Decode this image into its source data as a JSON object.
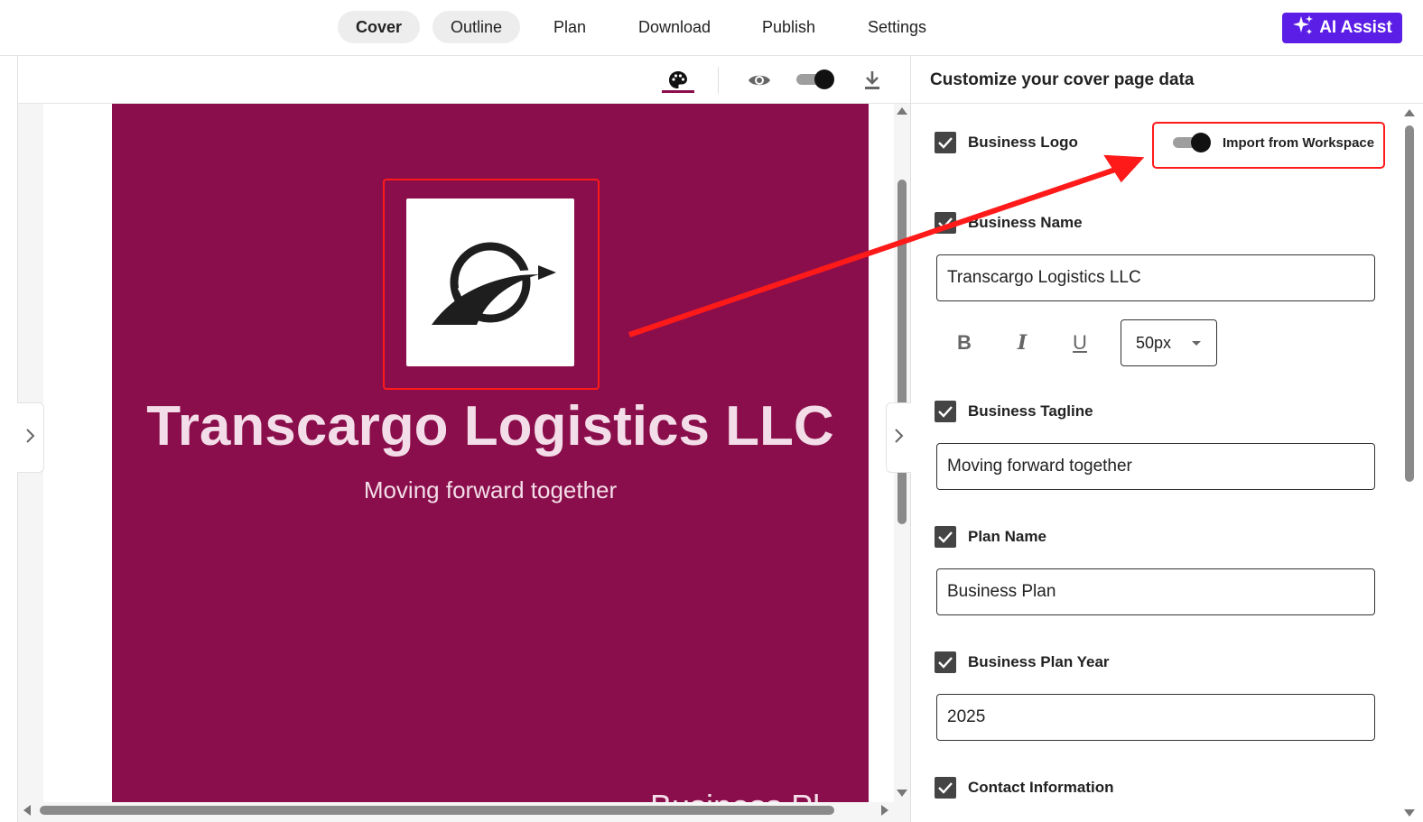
{
  "nav": {
    "tabs": [
      {
        "label": "Cover",
        "active": true
      },
      {
        "label": "Outline",
        "active": false
      },
      {
        "label": "Plan",
        "active": false
      },
      {
        "label": "Download",
        "active": false
      },
      {
        "label": "Publish",
        "active": false
      },
      {
        "label": "Settings",
        "active": false
      }
    ],
    "ai_button": {
      "label": "AI Assist",
      "icon": "sparkles-icon",
      "color": "#5b1ee6"
    }
  },
  "toolbar": {
    "icons": [
      "palette-icon",
      "eye-icon",
      "toggle",
      "download-icon"
    ],
    "active_accent": "#8b0d4c"
  },
  "cover_preview": {
    "background": "#8a0e4b",
    "logo_icon": "arrow-swoosh-logo",
    "business_name": "Transcargo Logistics LLC",
    "tagline": "Moving forward together",
    "plan_name_partial": "Business Pl"
  },
  "panel": {
    "title": "Customize your cover page data",
    "import_toggle": {
      "label": "Import from Workspace",
      "on": true
    },
    "sections": [
      {
        "label": "Business Logo",
        "checked": true
      },
      {
        "label": "Business Name",
        "checked": true,
        "value": "Transcargo Logistics LLC"
      },
      {
        "label": "Business Tagline",
        "checked": true,
        "value": "Moving forward together"
      },
      {
        "label": "Plan Name",
        "checked": true,
        "value": "Business Plan"
      },
      {
        "label": "Business Plan Year",
        "checked": true,
        "value": "2025"
      },
      {
        "label": "Contact Information",
        "checked": true
      }
    ],
    "format": {
      "bold": "B",
      "italic": "I",
      "underline": "U",
      "font_size": "50px"
    }
  },
  "annotation_color": "#ff1a1a"
}
